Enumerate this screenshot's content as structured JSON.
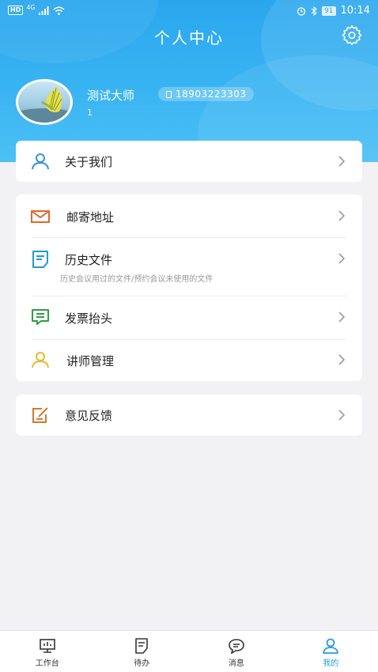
{
  "status_bar": {
    "hd": "HD",
    "network": "4G",
    "battery": "91",
    "time": "10:14"
  },
  "header": {
    "title": "个人中心",
    "settings_icon": "gear-icon"
  },
  "profile": {
    "name": "测试大师",
    "phone": "18903223303",
    "sub": "1"
  },
  "menu": {
    "about": {
      "label": "关于我们",
      "icon": "person-icon"
    },
    "mail": {
      "label": "邮寄地址",
      "icon": "mail-icon"
    },
    "history": {
      "label": "历史文件",
      "desc": "历史会议用过的文件/预约会议未使用的文件",
      "icon": "document-icon"
    },
    "invoice": {
      "label": "发票抬头",
      "icon": "invoice-icon"
    },
    "lecturer": {
      "label": "讲师管理",
      "icon": "person-icon"
    },
    "feedback": {
      "label": "意见反馈",
      "icon": "edit-icon"
    }
  },
  "tabbar": {
    "tabs": [
      {
        "label": "工作台",
        "icon": "dashboard-icon"
      },
      {
        "label": "待办",
        "icon": "todo-icon"
      },
      {
        "label": "消息",
        "icon": "message-icon"
      },
      {
        "label": "我的",
        "icon": "person-icon",
        "active": true
      }
    ],
    "active_color": "#2a9ae6"
  },
  "colors": {
    "header_blue": "#2aa6ee",
    "mail_orange": "#e0662e",
    "doc_blue": "#1e9bd7",
    "invoice_green": "#2e9e46",
    "lecturer_yellow": "#e8b92a",
    "feedback_orange": "#d8772f"
  }
}
